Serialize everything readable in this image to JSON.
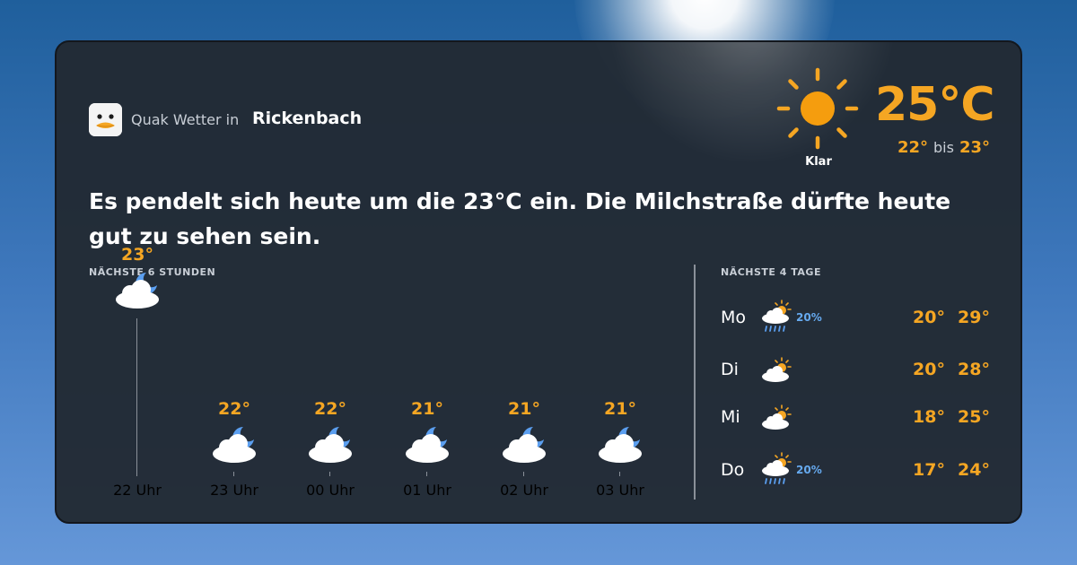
{
  "brand": {
    "name": "Quak Wetter in",
    "city": "Rickenbach"
  },
  "current": {
    "temperature": "25°C",
    "condition": "Klar",
    "min": "22°",
    "range_word": "bis",
    "max": "23°",
    "icon": "sun-icon"
  },
  "headline": "Es pendelt sich heute um die 23°C ein. Die Milchstraße dürfte heute gut zu sehen sein.",
  "hourly": {
    "label": "NÄCHSTE 6 STUNDEN",
    "items": [
      {
        "time": "22 Uhr",
        "temp": "23°",
        "temp_value": 23,
        "icon": "cloud-moon-icon"
      },
      {
        "time": "23 Uhr",
        "temp": "22°",
        "temp_value": 22,
        "icon": "cloud-moon-icon"
      },
      {
        "time": "00 Uhr",
        "temp": "22°",
        "temp_value": 22,
        "icon": "cloud-moon-icon"
      },
      {
        "time": "01 Uhr",
        "temp": "21°",
        "temp_value": 21,
        "icon": "cloud-moon-icon"
      },
      {
        "time": "02 Uhr",
        "temp": "21°",
        "temp_value": 21,
        "icon": "cloud-moon-icon"
      },
      {
        "time": "03 Uhr",
        "temp": "21°",
        "temp_value": 21,
        "icon": "cloud-moon-icon"
      }
    ]
  },
  "daily": {
    "label": "NÄCHSTE 4 TAGE",
    "items": [
      {
        "day": "Mo",
        "icon": "sun-cloud-rain-icon",
        "precip": "20%",
        "low": "20°",
        "high": "29°"
      },
      {
        "day": "Di",
        "icon": "sun-cloud-icon",
        "precip": "",
        "low": "20°",
        "high": "28°"
      },
      {
        "day": "Mi",
        "icon": "sun-cloud-icon",
        "precip": "",
        "low": "18°",
        "high": "25°"
      },
      {
        "day": "Do",
        "icon": "sun-cloud-rain-icon",
        "precip": "20%",
        "low": "17°",
        "high": "24°"
      }
    ]
  },
  "colors": {
    "accent": "#f5a623",
    "precip": "#66aaf0",
    "card": "#222a34"
  }
}
